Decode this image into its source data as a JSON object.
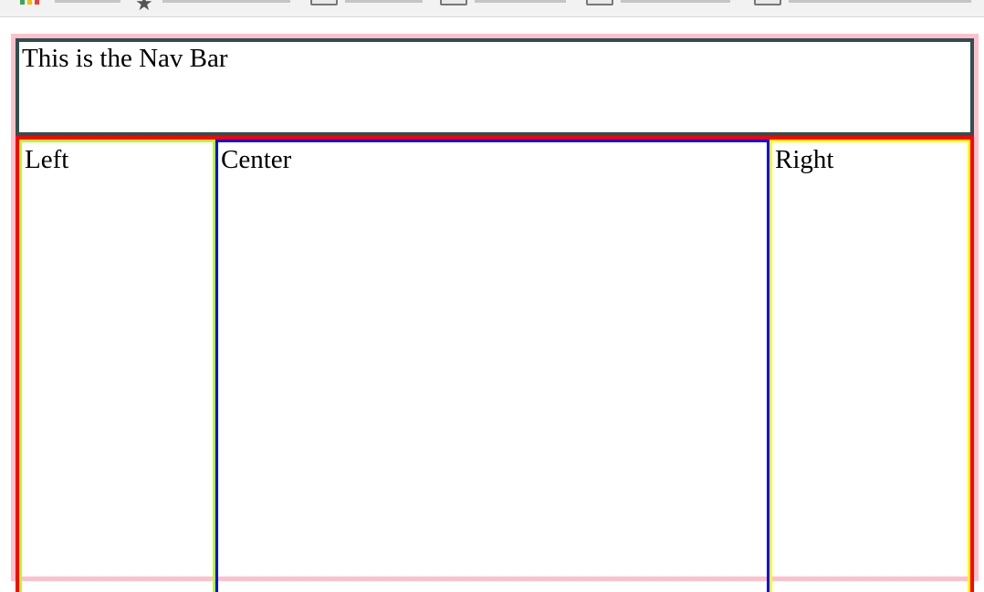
{
  "navbar": {
    "text": "This is the Nav Bar"
  },
  "columns": {
    "left": {
      "text": "Left"
    },
    "center": {
      "text": "Center"
    },
    "right": {
      "text": "Right"
    }
  },
  "colors": {
    "wrapper_border": "#ffc0cb",
    "navbar_border": "#2f4f4f",
    "content_border": "#ff0000",
    "left_border": "#adff2f",
    "center_border": "#0000ff",
    "right_border": "#ffff00"
  },
  "icons": {
    "apps": "apps-grid-icon",
    "bookmark": "star-icon",
    "folder": "folder-icon"
  }
}
